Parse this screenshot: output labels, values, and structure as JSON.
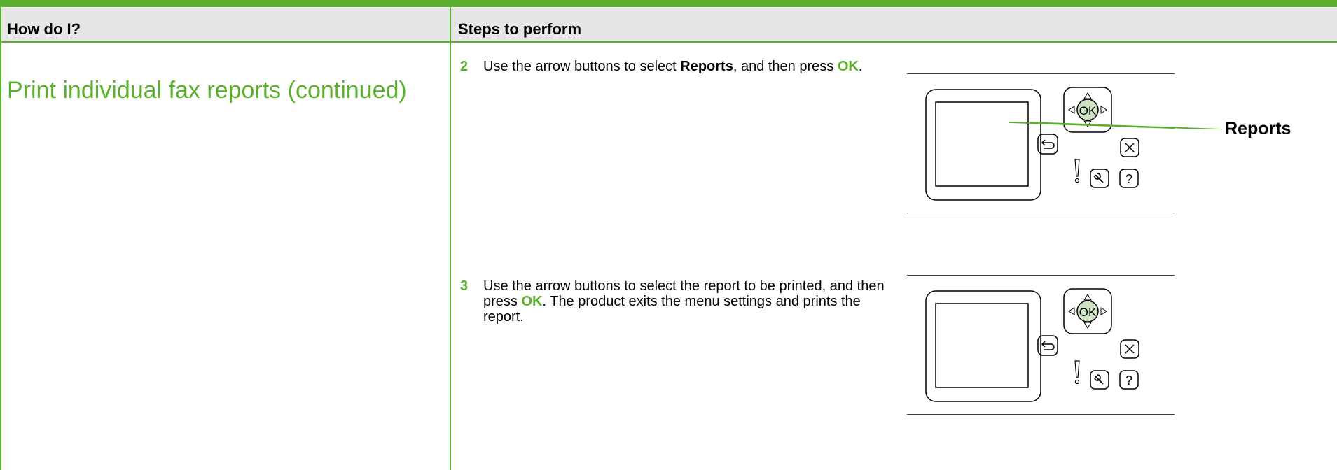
{
  "header": {
    "col1": "How do I?",
    "col2": "Steps to perform"
  },
  "task": {
    "title": "Print individual fax reports (continued)"
  },
  "steps": [
    {
      "number": "2",
      "text_a": "Use the arrow buttons to select ",
      "bold_a": "Reports",
      "text_b": ", and then press ",
      "ok": "OK",
      "text_c": "."
    },
    {
      "number": "3",
      "text_a": "Use the arrow buttons to select the report to be printed, and then press ",
      "ok": "OK",
      "text_b": ". The product exits the menu settings and prints the report."
    }
  ],
  "panel": {
    "ok_label": "OK",
    "callout": "Reports",
    "icons": [
      "back-icon",
      "cancel-icon",
      "setup-wrench-icon",
      "help-icon",
      "attention-icon",
      "arrow-up-icon",
      "arrow-down-icon",
      "arrow-left-icon",
      "arrow-right-icon"
    ]
  },
  "colors": {
    "accent": "#5aaf2c",
    "header_bg": "#e6e6e6",
    "ok_button": "#cfe3c2"
  }
}
